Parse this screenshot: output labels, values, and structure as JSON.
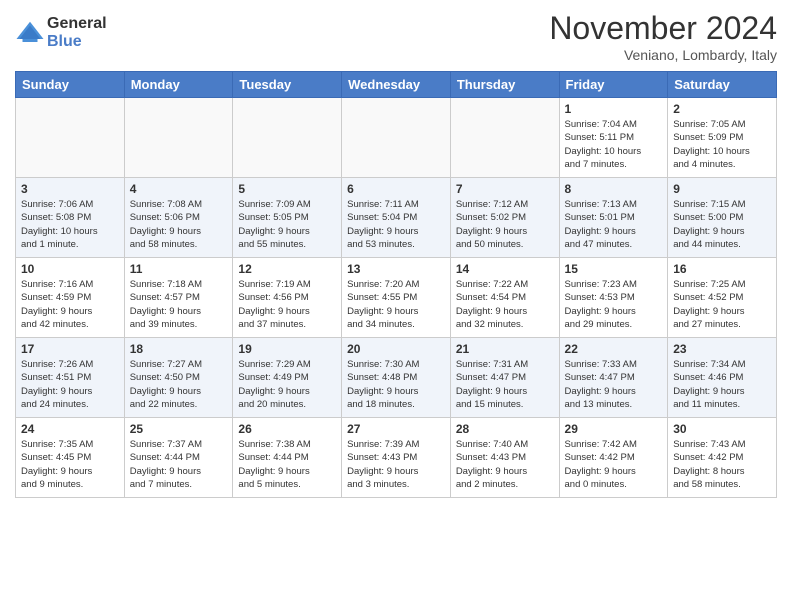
{
  "logo": {
    "line1": "General",
    "line2": "Blue"
  },
  "title": "November 2024",
  "subtitle": "Veniano, Lombardy, Italy",
  "days_of_week": [
    "Sunday",
    "Monday",
    "Tuesday",
    "Wednesday",
    "Thursday",
    "Friday",
    "Saturday"
  ],
  "weeks": [
    [
      {
        "day": "",
        "info": ""
      },
      {
        "day": "",
        "info": ""
      },
      {
        "day": "",
        "info": ""
      },
      {
        "day": "",
        "info": ""
      },
      {
        "day": "",
        "info": ""
      },
      {
        "day": "1",
        "info": "Sunrise: 7:04 AM\nSunset: 5:11 PM\nDaylight: 10 hours\nand 7 minutes."
      },
      {
        "day": "2",
        "info": "Sunrise: 7:05 AM\nSunset: 5:09 PM\nDaylight: 10 hours\nand 4 minutes."
      }
    ],
    [
      {
        "day": "3",
        "info": "Sunrise: 7:06 AM\nSunset: 5:08 PM\nDaylight: 10 hours\nand 1 minute."
      },
      {
        "day": "4",
        "info": "Sunrise: 7:08 AM\nSunset: 5:06 PM\nDaylight: 9 hours\nand 58 minutes."
      },
      {
        "day": "5",
        "info": "Sunrise: 7:09 AM\nSunset: 5:05 PM\nDaylight: 9 hours\nand 55 minutes."
      },
      {
        "day": "6",
        "info": "Sunrise: 7:11 AM\nSunset: 5:04 PM\nDaylight: 9 hours\nand 53 minutes."
      },
      {
        "day": "7",
        "info": "Sunrise: 7:12 AM\nSunset: 5:02 PM\nDaylight: 9 hours\nand 50 minutes."
      },
      {
        "day": "8",
        "info": "Sunrise: 7:13 AM\nSunset: 5:01 PM\nDaylight: 9 hours\nand 47 minutes."
      },
      {
        "day": "9",
        "info": "Sunrise: 7:15 AM\nSunset: 5:00 PM\nDaylight: 9 hours\nand 44 minutes."
      }
    ],
    [
      {
        "day": "10",
        "info": "Sunrise: 7:16 AM\nSunset: 4:59 PM\nDaylight: 9 hours\nand 42 minutes."
      },
      {
        "day": "11",
        "info": "Sunrise: 7:18 AM\nSunset: 4:57 PM\nDaylight: 9 hours\nand 39 minutes."
      },
      {
        "day": "12",
        "info": "Sunrise: 7:19 AM\nSunset: 4:56 PM\nDaylight: 9 hours\nand 37 minutes."
      },
      {
        "day": "13",
        "info": "Sunrise: 7:20 AM\nSunset: 4:55 PM\nDaylight: 9 hours\nand 34 minutes."
      },
      {
        "day": "14",
        "info": "Sunrise: 7:22 AM\nSunset: 4:54 PM\nDaylight: 9 hours\nand 32 minutes."
      },
      {
        "day": "15",
        "info": "Sunrise: 7:23 AM\nSunset: 4:53 PM\nDaylight: 9 hours\nand 29 minutes."
      },
      {
        "day": "16",
        "info": "Sunrise: 7:25 AM\nSunset: 4:52 PM\nDaylight: 9 hours\nand 27 minutes."
      }
    ],
    [
      {
        "day": "17",
        "info": "Sunrise: 7:26 AM\nSunset: 4:51 PM\nDaylight: 9 hours\nand 24 minutes."
      },
      {
        "day": "18",
        "info": "Sunrise: 7:27 AM\nSunset: 4:50 PM\nDaylight: 9 hours\nand 22 minutes."
      },
      {
        "day": "19",
        "info": "Sunrise: 7:29 AM\nSunset: 4:49 PM\nDaylight: 9 hours\nand 20 minutes."
      },
      {
        "day": "20",
        "info": "Sunrise: 7:30 AM\nSunset: 4:48 PM\nDaylight: 9 hours\nand 18 minutes."
      },
      {
        "day": "21",
        "info": "Sunrise: 7:31 AM\nSunset: 4:47 PM\nDaylight: 9 hours\nand 15 minutes."
      },
      {
        "day": "22",
        "info": "Sunrise: 7:33 AM\nSunset: 4:47 PM\nDaylight: 9 hours\nand 13 minutes."
      },
      {
        "day": "23",
        "info": "Sunrise: 7:34 AM\nSunset: 4:46 PM\nDaylight: 9 hours\nand 11 minutes."
      }
    ],
    [
      {
        "day": "24",
        "info": "Sunrise: 7:35 AM\nSunset: 4:45 PM\nDaylight: 9 hours\nand 9 minutes."
      },
      {
        "day": "25",
        "info": "Sunrise: 7:37 AM\nSunset: 4:44 PM\nDaylight: 9 hours\nand 7 minutes."
      },
      {
        "day": "26",
        "info": "Sunrise: 7:38 AM\nSunset: 4:44 PM\nDaylight: 9 hours\nand 5 minutes."
      },
      {
        "day": "27",
        "info": "Sunrise: 7:39 AM\nSunset: 4:43 PM\nDaylight: 9 hours\nand 3 minutes."
      },
      {
        "day": "28",
        "info": "Sunrise: 7:40 AM\nSunset: 4:43 PM\nDaylight: 9 hours\nand 2 minutes."
      },
      {
        "day": "29",
        "info": "Sunrise: 7:42 AM\nSunset: 4:42 PM\nDaylight: 9 hours\nand 0 minutes."
      },
      {
        "day": "30",
        "info": "Sunrise: 7:43 AM\nSunset: 4:42 PM\nDaylight: 8 hours\nand 58 minutes."
      }
    ]
  ]
}
